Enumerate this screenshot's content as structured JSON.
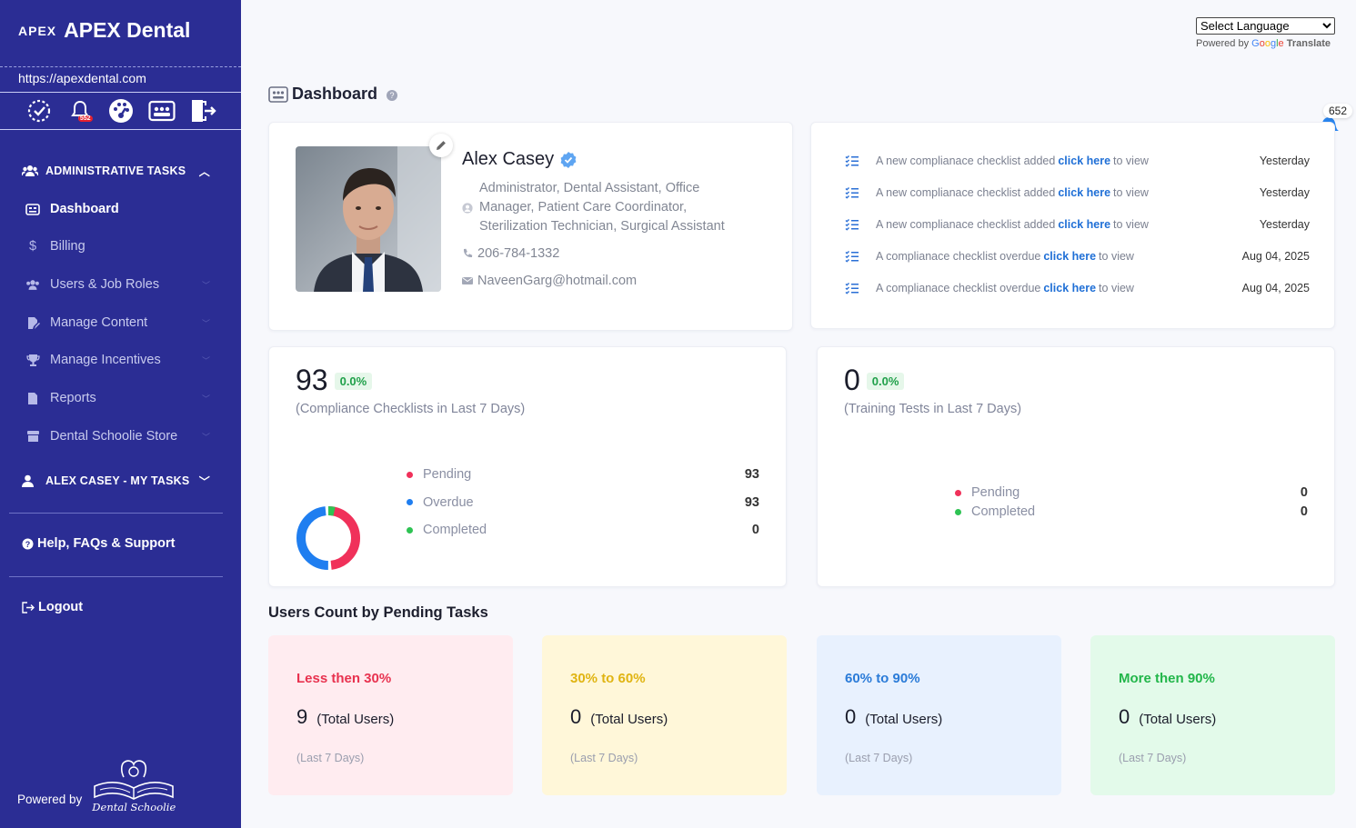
{
  "app": {
    "logo_mark": "APEX",
    "name": "APEX Dental",
    "url": "https://apexdental.com"
  },
  "header": {
    "language_select": "Select Language",
    "powered_by": "Powered by",
    "translate": "Translate",
    "notification_count": "652",
    "alert_badge": "552"
  },
  "page": {
    "title": "Dashboard"
  },
  "sidebar": {
    "admin_group": "ADMINISTRATIVE TASKS",
    "items": [
      {
        "label": "Dashboard"
      },
      {
        "label": "Billing"
      },
      {
        "label": "Users & Job Roles"
      },
      {
        "label": "Manage Content"
      },
      {
        "label": "Manage Incentives"
      },
      {
        "label": "Reports"
      },
      {
        "label": "Dental Schoolie Store"
      }
    ],
    "my_tasks_group": "ALEX CASEY - MY TASKS",
    "help": "Help, FAQs & Support",
    "logout": "Logout",
    "powered_by": "Powered by",
    "brand": "Dental Schoolie"
  },
  "profile": {
    "name": "Alex Casey",
    "roles": "Administrator, Dental Assistant, Office Manager, Patient Care Coordinator, Sterilization Technician, Surgical Assistant",
    "phone": "206-784-1332",
    "email": "NaveenGarg@hotmail.com"
  },
  "notifications": [
    {
      "before": "A new complianace checklist added",
      "link": "click here",
      "after": "to view",
      "date": "Yesterday"
    },
    {
      "before": "A new complianace checklist added",
      "link": "click here",
      "after": "to view",
      "date": "Yesterday"
    },
    {
      "before": "A new complianace checklist added",
      "link": "click here",
      "after": "to view",
      "date": "Yesterday"
    },
    {
      "before": "A complianace checklist overdue",
      "link": "click here",
      "after": "to view",
      "date": "Aug 04, 2025"
    },
    {
      "before": "A complianace checklist overdue",
      "link": "click here",
      "after": "to view",
      "date": "Aug 04, 2025"
    }
  ],
  "compliance": {
    "total": "93",
    "change": "0.0%",
    "caption": "(Compliance Checklists in Last 7 Days)",
    "legend": [
      {
        "label": "Pending",
        "value": "93",
        "color": "#f0315a"
      },
      {
        "label": "Overdue",
        "value": "93",
        "color": "#1f7ef0"
      },
      {
        "label": "Completed",
        "value": "0",
        "color": "#2ec353"
      }
    ]
  },
  "training": {
    "total": "0",
    "change": "0.0%",
    "caption": "(Training Tests in Last 7 Days)",
    "legend": [
      {
        "label": "Pending",
        "value": "0",
        "color": "#f0315a"
      },
      {
        "label": "Completed",
        "value": "0",
        "color": "#2ec353"
      }
    ]
  },
  "chart_data": {
    "type": "pie",
    "categories": [
      "Pending",
      "Overdue",
      "Completed"
    ],
    "values": [
      93,
      93,
      0
    ],
    "colors": [
      "#f0315a",
      "#1f7ef0",
      "#2ec353"
    ],
    "donut": true
  },
  "users_count": {
    "title": "Users Count by Pending Tasks",
    "tiers": [
      {
        "label": "Less then 30%",
        "count": "9",
        "unit": "(Total Users)",
        "period": "(Last 7 Days)",
        "color": "#e8324f",
        "bg": "#ffecf0"
      },
      {
        "label": "30% to 60%",
        "count": "0",
        "unit": "(Total Users)",
        "period": "(Last 7 Days)",
        "color": "#e0b412",
        "bg": "#fff7d9"
      },
      {
        "label": "60% to 90%",
        "count": "0",
        "unit": "(Total Users)",
        "period": "(Last 7 Days)",
        "color": "#2a7bd8",
        "bg": "#e8f1fe"
      },
      {
        "label": "More then 90%",
        "count": "0",
        "unit": "(Total Users)",
        "period": "(Last 7 Days)",
        "color": "#22b64a",
        "bg": "#e3faea"
      }
    ]
  }
}
